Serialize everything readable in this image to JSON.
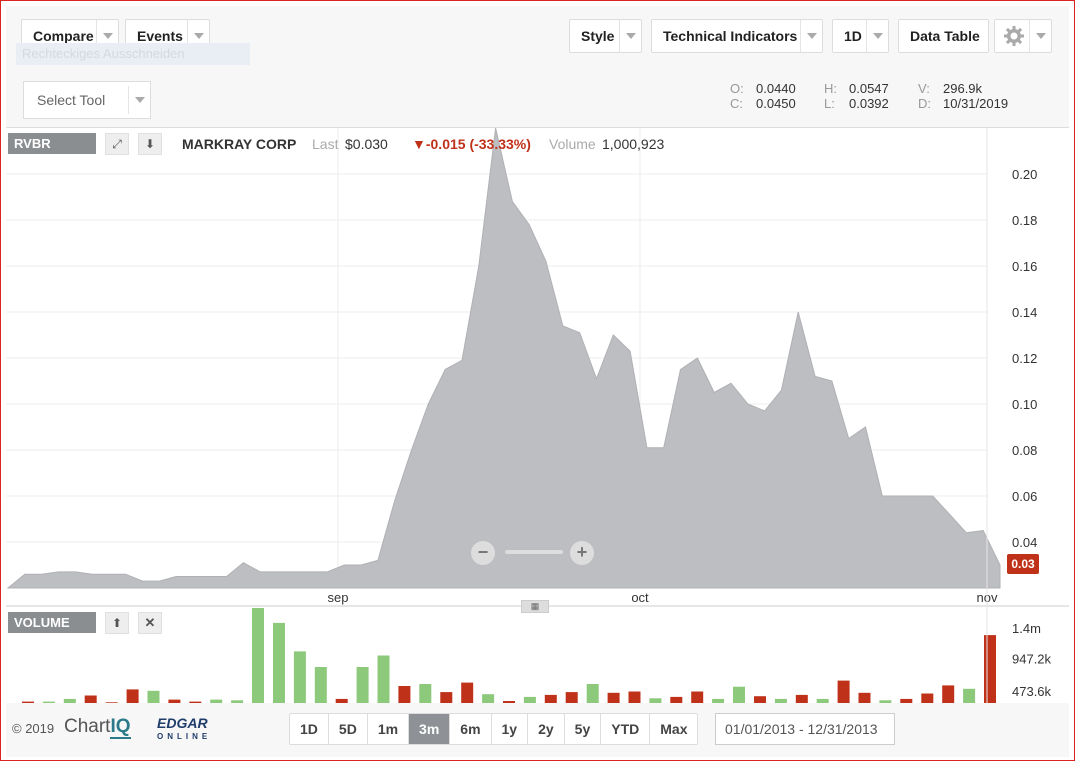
{
  "toolbar": {
    "compare": "Compare",
    "events": "Events",
    "style": "Style",
    "technical_indicators": "Technical Indicators",
    "interval": "1D",
    "data_table": "Data Table",
    "ghost_text": "Rechteckiges Ausschneiden",
    "settings_icon": "gear-icon"
  },
  "tool": {
    "select_tool": "Select Tool"
  },
  "ohlc": {
    "o_label": "O:",
    "o_value": "0.0440",
    "c_label": "C:",
    "c_value": "0.0450",
    "h_label": "H:",
    "h_value": "0.0547",
    "l_label": "L:",
    "l_value": "0.0392",
    "v_label": "V:",
    "v_value": "296.9k",
    "d_label": "D:",
    "d_value": "10/31/2019"
  },
  "quote": {
    "symbol": "RVBR",
    "name": "MARKRAY CORP",
    "last_label": "Last",
    "last_value": "$0.030",
    "change": "▼-0.015 (-33.33%)",
    "volume_label": "Volume",
    "volume_value": "1,000,923",
    "current_price_tag": "0.03"
  },
  "volume_panel": {
    "label": "VOLUME"
  },
  "chart_data": [
    {
      "type": "area",
      "title": "",
      "xlabel": "",
      "ylabel": "",
      "y_ticks": [
        "0.20",
        "0.18",
        "0.16",
        "0.14",
        "0.12",
        "0.10",
        "0.08",
        "0.06",
        "0.04"
      ],
      "x_ticks": [
        "sep",
        "oct",
        "nov"
      ],
      "ylim": [
        0.02,
        0.22
      ],
      "grid": true,
      "color": "#bdbec1",
      "x": [
        1,
        3,
        6,
        9,
        12,
        15,
        18,
        21,
        23,
        25,
        27,
        29,
        31,
        33,
        35,
        37,
        39,
        41,
        43,
        45,
        47,
        49,
        51,
        53,
        55,
        57,
        59,
        61,
        63,
        65,
        67,
        69,
        71,
        73,
        75,
        77,
        79,
        81,
        83,
        85,
        87,
        89,
        91,
        93,
        95,
        97,
        99,
        101,
        103,
        105,
        107,
        109,
        111,
        113,
        115,
        117,
        119,
        121,
        123,
        125,
        127,
        129,
        131,
        133,
        135,
        137,
        139,
        141,
        143,
        145,
        147,
        149,
        151,
        153,
        155,
        157,
        159,
        161,
        163,
        165,
        167,
        169,
        171,
        173,
        175,
        177,
        179
      ],
      "values": [
        0.02,
        0.026,
        0.026,
        0.027,
        0.027,
        0.026,
        0.026,
        0.026,
        0.023,
        0.023,
        0.025,
        0.025,
        0.025,
        0.025,
        0.031,
        0.027,
        0.027,
        0.027,
        0.027,
        0.027,
        0.03,
        0.03,
        0.032,
        0.058,
        0.08,
        0.1,
        0.115,
        0.119,
        0.16,
        0.22,
        0.188,
        0.178,
        0.162,
        0.134,
        0.131,
        0.111,
        0.13,
        0.123,
        0.081,
        0.081,
        0.115,
        0.12,
        0.105,
        0.109,
        0.1,
        0.097,
        0.106,
        0.14,
        0.112,
        0.11,
        0.085,
        0.09,
        0.06,
        0.06,
        0.06,
        0.06,
        0.052,
        0.044,
        0.045,
        0.03
      ],
      "series": [
        {
          "name": "RVBR",
          "values": []
        }
      ]
    },
    {
      "type": "bar",
      "title": "",
      "y_ticks": [
        "1.4m",
        "947.2k",
        "473.6k"
      ],
      "ylim": [
        0,
        1400000
      ],
      "up_color": "#8cc97b",
      "down_color": "#c0311a",
      "bars": [
        {
          "v": 20000,
          "d": "down"
        },
        {
          "v": 20000,
          "d": "up"
        },
        {
          "v": 60000,
          "d": "up"
        },
        {
          "v": 110000,
          "d": "down"
        },
        {
          "v": 10000,
          "d": "down"
        },
        {
          "v": 200000,
          "d": "down"
        },
        {
          "v": 180000,
          "d": "up"
        },
        {
          "v": 50000,
          "d": "down"
        },
        {
          "v": 20000,
          "d": "down"
        },
        {
          "v": 50000,
          "d": "up"
        },
        {
          "v": 40000,
          "d": "up"
        },
        {
          "v": 1400000,
          "d": "up"
        },
        {
          "v": 1180000,
          "d": "up"
        },
        {
          "v": 760000,
          "d": "up"
        },
        {
          "v": 530000,
          "d": "up"
        },
        {
          "v": 60000,
          "d": "down"
        },
        {
          "v": 530000,
          "d": "up"
        },
        {
          "v": 700000,
          "d": "up"
        },
        {
          "v": 250000,
          "d": "down"
        },
        {
          "v": 280000,
          "d": "up"
        },
        {
          "v": 160000,
          "d": "down"
        },
        {
          "v": 300000,
          "d": "down"
        },
        {
          "v": 130000,
          "d": "up"
        },
        {
          "v": 30000,
          "d": "down"
        },
        {
          "v": 90000,
          "d": "up"
        },
        {
          "v": 120000,
          "d": "down"
        },
        {
          "v": 160000,
          "d": "down"
        },
        {
          "v": 280000,
          "d": "up"
        },
        {
          "v": 150000,
          "d": "down"
        },
        {
          "v": 170000,
          "d": "down"
        },
        {
          "v": 70000,
          "d": "up"
        },
        {
          "v": 90000,
          "d": "down"
        },
        {
          "v": 170000,
          "d": "down"
        },
        {
          "v": 60000,
          "d": "up"
        },
        {
          "v": 240000,
          "d": "up"
        },
        {
          "v": 100000,
          "d": "down"
        },
        {
          "v": 60000,
          "d": "up"
        },
        {
          "v": 120000,
          "d": "down"
        },
        {
          "v": 60000,
          "d": "up"
        },
        {
          "v": 330000,
          "d": "down"
        },
        {
          "v": 150000,
          "d": "down"
        },
        {
          "v": 40000,
          "d": "up"
        },
        {
          "v": 60000,
          "d": "down"
        },
        {
          "v": 140000,
          "d": "down"
        },
        {
          "v": 260000,
          "d": "down"
        },
        {
          "v": 210000,
          "d": "up"
        },
        {
          "v": 1000000,
          "d": "down"
        }
      ]
    }
  ],
  "footer": {
    "copyright": "© 2019",
    "brand_chart": "Chart",
    "brand_iq": "IQ",
    "brand_edgar": "EDGAR",
    "brand_online": "ONLINE",
    "ranges": [
      "1D",
      "5D",
      "1m",
      "3m",
      "6m",
      "1y",
      "2y",
      "5y",
      "YTD",
      "Max"
    ],
    "active_range": "3m",
    "date_range": "01/01/2013 - 12/31/2013"
  }
}
